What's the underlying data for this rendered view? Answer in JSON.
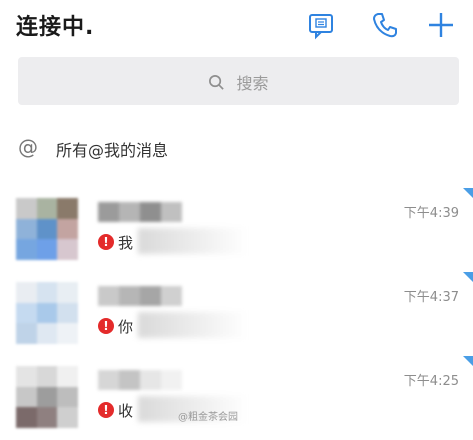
{
  "header": {
    "title": "连接中.",
    "icons": [
      "chat-icon",
      "phone-icon",
      "plus-icon"
    ],
    "accent": "#2f83e0"
  },
  "search": {
    "placeholder": "搜索"
  },
  "mention": {
    "label": "所有@我的消息"
  },
  "conversations": [
    {
      "time": "下午4:39",
      "preview": "我",
      "avatar_colors": [
        "#c9c9c9",
        "#a9b3a1",
        "#8a7a6a",
        "#8fb2d9",
        "#5f92c9",
        "#c3a4a1",
        "#76a6e0",
        "#6ea0e8",
        "#d7c7cf"
      ],
      "name_colors": [
        "#9b9b9b",
        "#b5b5b5",
        "#8f8f8f",
        "#c0c0c0"
      ]
    },
    {
      "time": "下午4:37",
      "preview": "你",
      "avatar_colors": [
        "#e9edf2",
        "#d6e3f0",
        "#e8eef3",
        "#c5daf0",
        "#a9c9ea",
        "#d2e0ee",
        "#bfd3e8",
        "#dfe8f2",
        "#eef2f6"
      ],
      "name_colors": [
        "#c9c9c9",
        "#b6b6b6",
        "#a6a6a6",
        "#d0d0d0"
      ]
    },
    {
      "time": "下午4:25",
      "preview": "收",
      "avatar_colors": [
        "#e4e4e4",
        "#d8d8d8",
        "#f0f0f0",
        "#c7c7c7",
        "#9d9d9d",
        "#bdbdbd",
        "#7b6a6a",
        "#8f8080",
        "#cfcfcf"
      ],
      "name_colors": [
        "#d6d6d6",
        "#c4c4c4",
        "#e6e6e6",
        "#f1f1f1"
      ]
    }
  ],
  "watermark": "@粗金茶会园"
}
